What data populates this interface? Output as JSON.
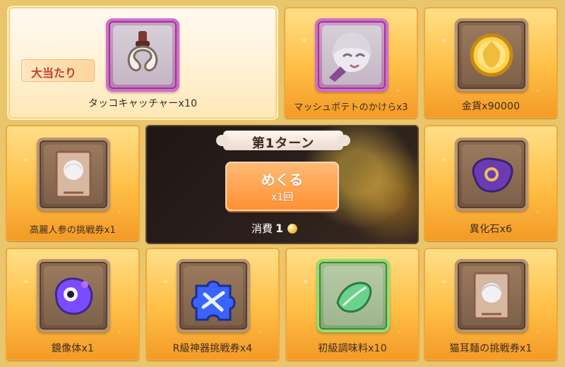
{
  "tiles": [
    {
      "id": "grand",
      "label": "タッコキャッチャーx10",
      "badge": "大当たり",
      "frame": "purple",
      "icon": "claw-icon"
    },
    {
      "id": "mash",
      "label": "マッシュポテトのかけらx3",
      "frame": "purple",
      "icon": "character-portrait-icon"
    },
    {
      "id": "gold",
      "label": "金貨x90000",
      "frame": "brown",
      "icon": "gold-coin-icon"
    },
    {
      "id": "korai",
      "label": "高麗人参の挑戦券x1",
      "frame": "brown",
      "icon": "challenge-ticket-icon"
    },
    {
      "id": "ika",
      "label": "異化石x6",
      "frame": "brown",
      "icon": "purple-stone-icon"
    },
    {
      "id": "kyozo",
      "label": "鏡像体x1",
      "frame": "brown",
      "icon": "mirror-slime-icon"
    },
    {
      "id": "rkyu",
      "label": "R級神器挑戦券x4",
      "frame": "brown",
      "icon": "blue-puzzle-icon"
    },
    {
      "id": "seasoning",
      "label": "初級調味料x10",
      "frame": "green",
      "icon": "green-leaf-icon"
    },
    {
      "id": "nekomimi",
      "label": "猫耳麺の挑戦券x1",
      "frame": "brown",
      "icon": "challenge-ticket-icon"
    }
  ],
  "center": {
    "turn": "第1ターン",
    "flip_button_main": "めくる",
    "flip_button_sub": "x1回",
    "consume_label": "消費",
    "consume_value": "1",
    "currency_icon": "coin-icon"
  }
}
